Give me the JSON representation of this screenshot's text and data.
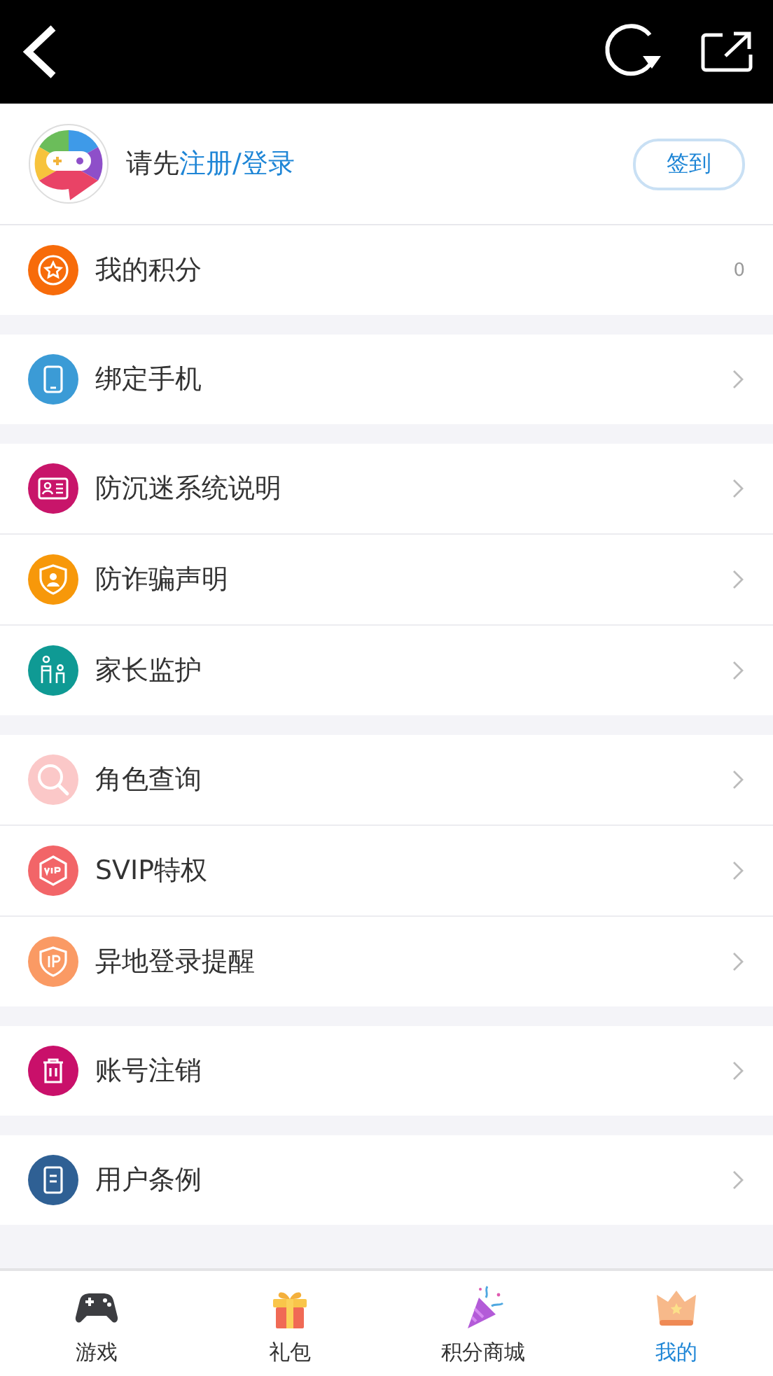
{
  "profile": {
    "prompt": "请先",
    "login_link": "注册/登录",
    "checkin_button": "签到"
  },
  "groups": [
    [
      {
        "kind": "star",
        "label": "我的积分",
        "value": "0",
        "color": "#f76b0a"
      }
    ],
    [
      {
        "kind": "phone",
        "label": "绑定手机",
        "color": "#3b9bd6"
      }
    ],
    [
      {
        "kind": "idcard",
        "label": "防沉迷系统说明",
        "color": "#c8156a"
      },
      {
        "kind": "shield",
        "label": "防诈骗声明",
        "color": "#f7980a"
      },
      {
        "kind": "family",
        "label": "家长监护",
        "color": "#0f9a94"
      }
    ],
    [
      {
        "kind": "search",
        "label": "角色查询",
        "color": "#fbc8c8"
      },
      {
        "kind": "vip",
        "label": "SVIP特权",
        "color": "#f26568"
      },
      {
        "kind": "ip",
        "label": "异地登录提醒",
        "color": "#fa9a64"
      }
    ],
    [
      {
        "kind": "trash",
        "label": "账号注销",
        "color": "#c9106a"
      }
    ],
    [
      {
        "kind": "doc",
        "label": "用户条例",
        "color": "#2f6094"
      }
    ]
  ],
  "tabs": [
    {
      "kind": "gamepad",
      "label": "游戏",
      "selected": false
    },
    {
      "kind": "gift",
      "label": "礼包",
      "selected": false
    },
    {
      "kind": "party",
      "label": "积分商城",
      "selected": false
    },
    {
      "kind": "crown",
      "label": "我的",
      "selected": true
    }
  ]
}
